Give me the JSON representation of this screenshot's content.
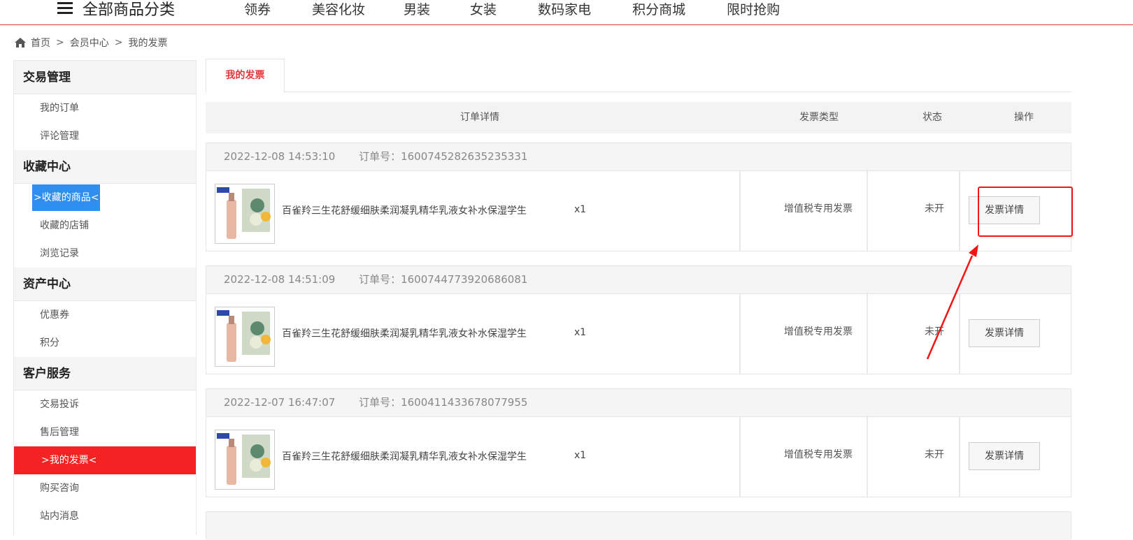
{
  "topnav": {
    "category_label": "全部商品分类",
    "links": [
      "领券",
      "美容化妆",
      "男装",
      "女装",
      "数码家电",
      "积分商城",
      "限时抢购"
    ]
  },
  "breadcrumb": {
    "home": "首页",
    "sep1": ">",
    "member": "会员中心",
    "sep2": ">",
    "current": "我的发票"
  },
  "sidebar": {
    "groups": [
      {
        "title": "交易管理",
        "items": [
          "我的订单",
          "评论管理"
        ]
      },
      {
        "title": "收藏中心",
        "items": [
          ">收藏的商品<",
          "收藏的店铺",
          "浏览记录"
        ]
      },
      {
        "title": "资产中心",
        "items": [
          "优惠券",
          "积分"
        ]
      },
      {
        "title": "客户服务",
        "items": [
          "交易投诉",
          "售后管理",
          ">我的发票<",
          "购买咨询",
          "站内消息"
        ]
      }
    ]
  },
  "tab": {
    "label": "我的发票"
  },
  "table": {
    "headers": {
      "detail": "订单详情",
      "type": "发票类型",
      "status": "状态",
      "action": "操作"
    }
  },
  "orders": [
    {
      "datetime": "2022-12-08 14:53:10",
      "order_no": "订单号：1600745282635235331",
      "product": "百雀羚三生花舒缓细肤柔润凝乳精华乳液女补水保湿学生",
      "qty": "x1",
      "invoice_type": "增值税专用发票",
      "status": "未开",
      "button": "发票详情"
    },
    {
      "datetime": "2022-12-08 14:51:09",
      "order_no": "订单号：1600744773920686081",
      "product": "百雀羚三生花舒缓细肤柔润凝乳精华乳液女补水保湿学生",
      "qty": "x1",
      "invoice_type": "增值税专用发票",
      "status": "未开",
      "button": "发票详情"
    },
    {
      "datetime": "2022-12-07 16:47:07",
      "order_no": "订单号：1600411433678077955",
      "product": "百雀羚三生花舒缓细肤柔润凝乳精华乳液女补水保湿学生",
      "qty": "x1",
      "invoice_type": "增值税专用发票",
      "status": "未开",
      "button": "发票详情"
    }
  ],
  "colors": {
    "accent_red": "#e4393c",
    "active_red": "#f42222",
    "active_blue": "#2e8ff0",
    "annotation": "#f31414"
  },
  "icons": {
    "menu": "hamburger-icon",
    "home": "home-icon"
  }
}
